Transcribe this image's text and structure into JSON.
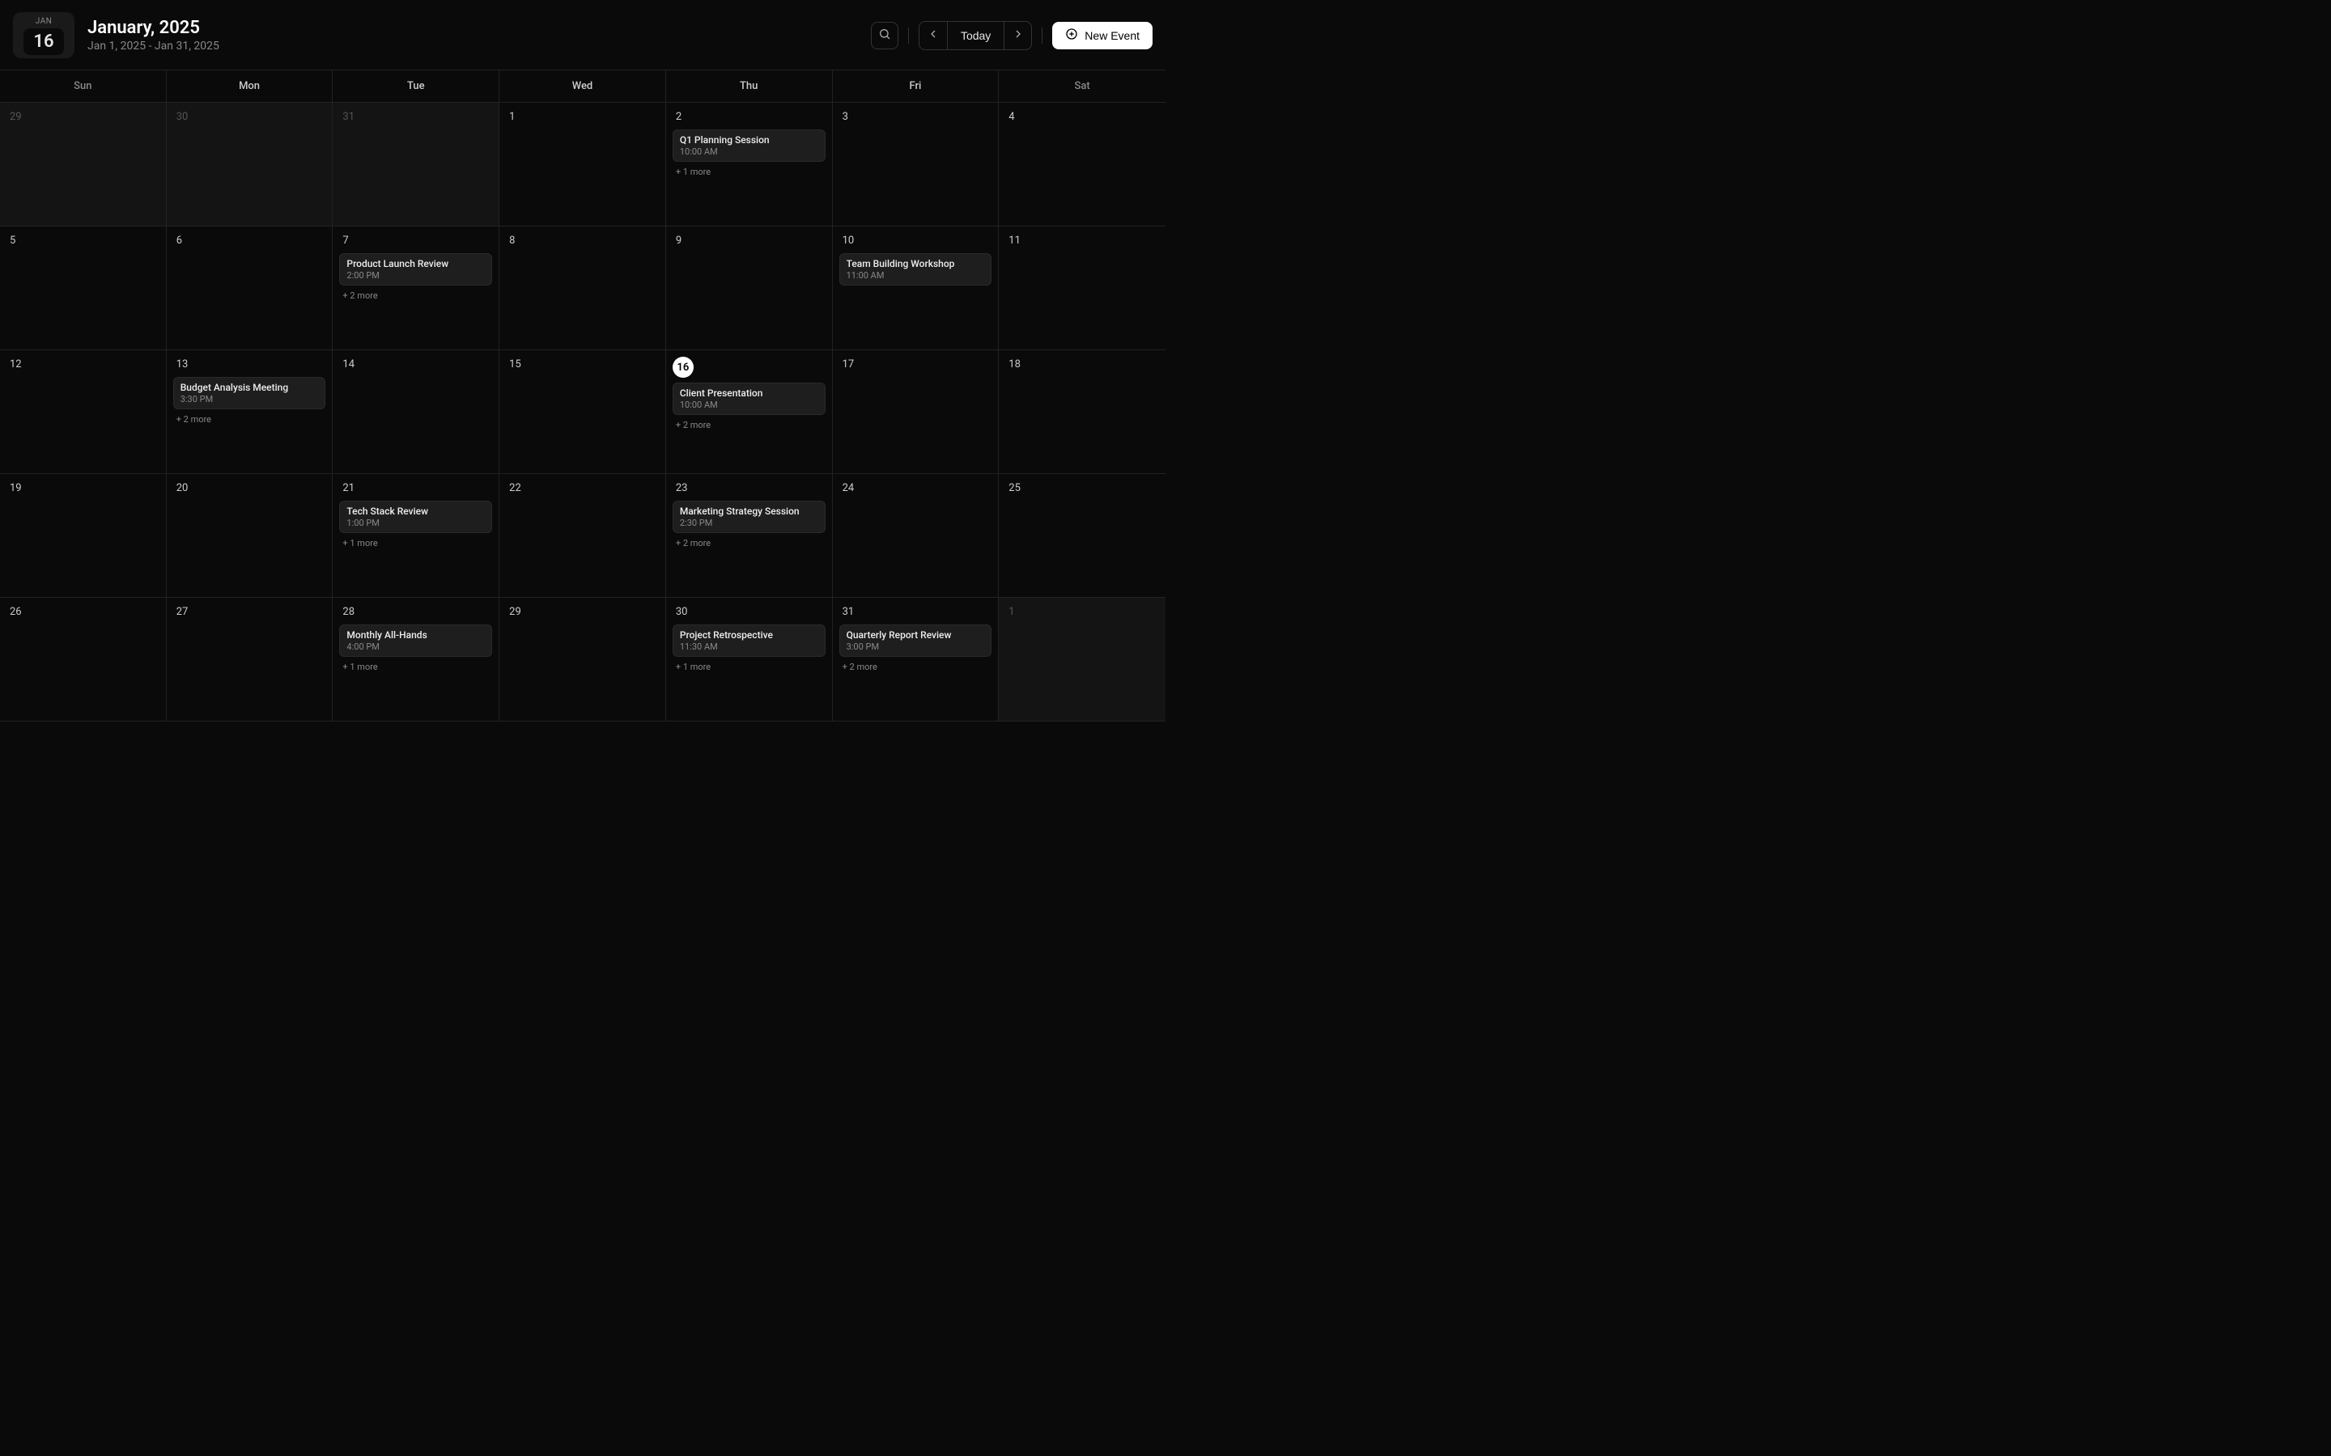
{
  "header": {
    "badge_month": "JAN",
    "badge_day": "16",
    "title": "January, 2025",
    "subtitle": "Jan 1, 2025 - Jan 31, 2025",
    "today_label": "Today",
    "new_event_label": "New Event"
  },
  "day_headers": [
    "Sun",
    "Mon",
    "Tue",
    "Wed",
    "Thu",
    "Fri",
    "Sat"
  ],
  "cells": [
    {
      "n": "29",
      "other": true
    },
    {
      "n": "30",
      "other": true
    },
    {
      "n": "31",
      "other": true
    },
    {
      "n": "1"
    },
    {
      "n": "2",
      "events": [
        {
          "title": "Q1 Planning Session",
          "time": "10:00 AM"
        }
      ],
      "more": "+ 1 more"
    },
    {
      "n": "3"
    },
    {
      "n": "4"
    },
    {
      "n": "5"
    },
    {
      "n": "6"
    },
    {
      "n": "7",
      "events": [
        {
          "title": "Product Launch Review",
          "time": "2:00 PM"
        }
      ],
      "more": "+ 2 more"
    },
    {
      "n": "8"
    },
    {
      "n": "9"
    },
    {
      "n": "10",
      "events": [
        {
          "title": "Team Building Workshop",
          "time": "11:00 AM"
        }
      ]
    },
    {
      "n": "11"
    },
    {
      "n": "12"
    },
    {
      "n": "13",
      "events": [
        {
          "title": "Budget Analysis Meeting",
          "time": "3:30 PM"
        }
      ],
      "more": "+ 2 more"
    },
    {
      "n": "14"
    },
    {
      "n": "15"
    },
    {
      "n": "16",
      "today": true,
      "events": [
        {
          "title": "Client Presentation",
          "time": "10:00 AM"
        }
      ],
      "more": "+ 2 more"
    },
    {
      "n": "17"
    },
    {
      "n": "18"
    },
    {
      "n": "19"
    },
    {
      "n": "20"
    },
    {
      "n": "21",
      "events": [
        {
          "title": "Tech Stack Review",
          "time": "1:00 PM"
        }
      ],
      "more": "+ 1 more"
    },
    {
      "n": "22"
    },
    {
      "n": "23",
      "events": [
        {
          "title": "Marketing Strategy Session",
          "time": "2:30 PM"
        }
      ],
      "more": "+ 2 more"
    },
    {
      "n": "24"
    },
    {
      "n": "25"
    },
    {
      "n": "26"
    },
    {
      "n": "27"
    },
    {
      "n": "28",
      "events": [
        {
          "title": "Monthly All-Hands",
          "time": "4:00 PM"
        }
      ],
      "more": "+ 1 more"
    },
    {
      "n": "29"
    },
    {
      "n": "30",
      "events": [
        {
          "title": "Project Retrospective",
          "time": "11:30 AM"
        }
      ],
      "more": "+ 1 more"
    },
    {
      "n": "31",
      "events": [
        {
          "title": "Quarterly Report Review",
          "time": "3:00 PM"
        }
      ],
      "more": "+ 2 more"
    },
    {
      "n": "1",
      "other": true
    }
  ]
}
